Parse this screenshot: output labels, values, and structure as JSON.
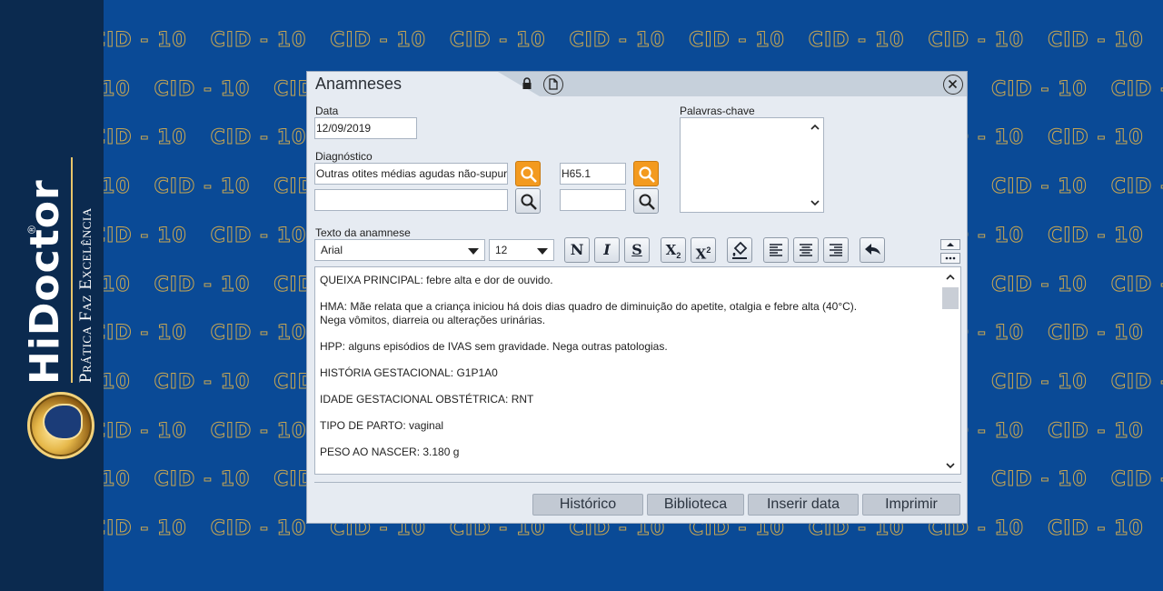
{
  "brand": {
    "name": "HiDoctor",
    "registered": "®",
    "tagline": "Prática Faz Excelência"
  },
  "watermark": {
    "text": "CID - 10",
    "color": "#c7a653"
  },
  "dialog": {
    "title": "Anamneses",
    "fields": {
      "date_label": "Data",
      "date_value": "12/09/2019",
      "diagnosis_label": "Diagnóstico",
      "diagnosis_1": "Outras otites médias agudas não-supuradas",
      "diagnosis_1_code": "H65.1",
      "diagnosis_2": "",
      "diagnosis_2_code": "",
      "keywords_label": "Palavras-chave",
      "keywords_value": ""
    },
    "editor": {
      "label": "Texto da anamnese",
      "font": "Arial",
      "size": "12",
      "toolbar": {
        "bold": "N",
        "italic": "I",
        "strike": "S",
        "subscript": "X",
        "superscript": "X"
      },
      "paragraphs": [
        "QUEIXA PRINCIPAL: febre alta e dor de ouvido.",
        "HMA: Mãe relata que a criança iniciou há dois dias quadro de diminuição do apetite, otalgia e  febre alta (40°C).",
        "Nega vômitos, diarreia ou alterações urinárias.",
        "HPP: alguns episódios de IVAS sem gravidade. Nega outras patologias.",
        "HISTÓRIA GESTACIONAL: G1P1A0",
        "IDADE GESTACIONAL OBSTÉTRICA: RNT",
        "TIPO DE PARTO: vaginal",
        "PESO AO NASCER: 3.180 g"
      ]
    },
    "footer": {
      "history": "Histórico",
      "library": "Biblioteca",
      "insert_date": "Inserir data",
      "print": "Imprimir"
    }
  },
  "colors": {
    "background": "#0a4a96",
    "brand_bar": "#0b2a4f",
    "search_orange": "#f39a1f"
  }
}
